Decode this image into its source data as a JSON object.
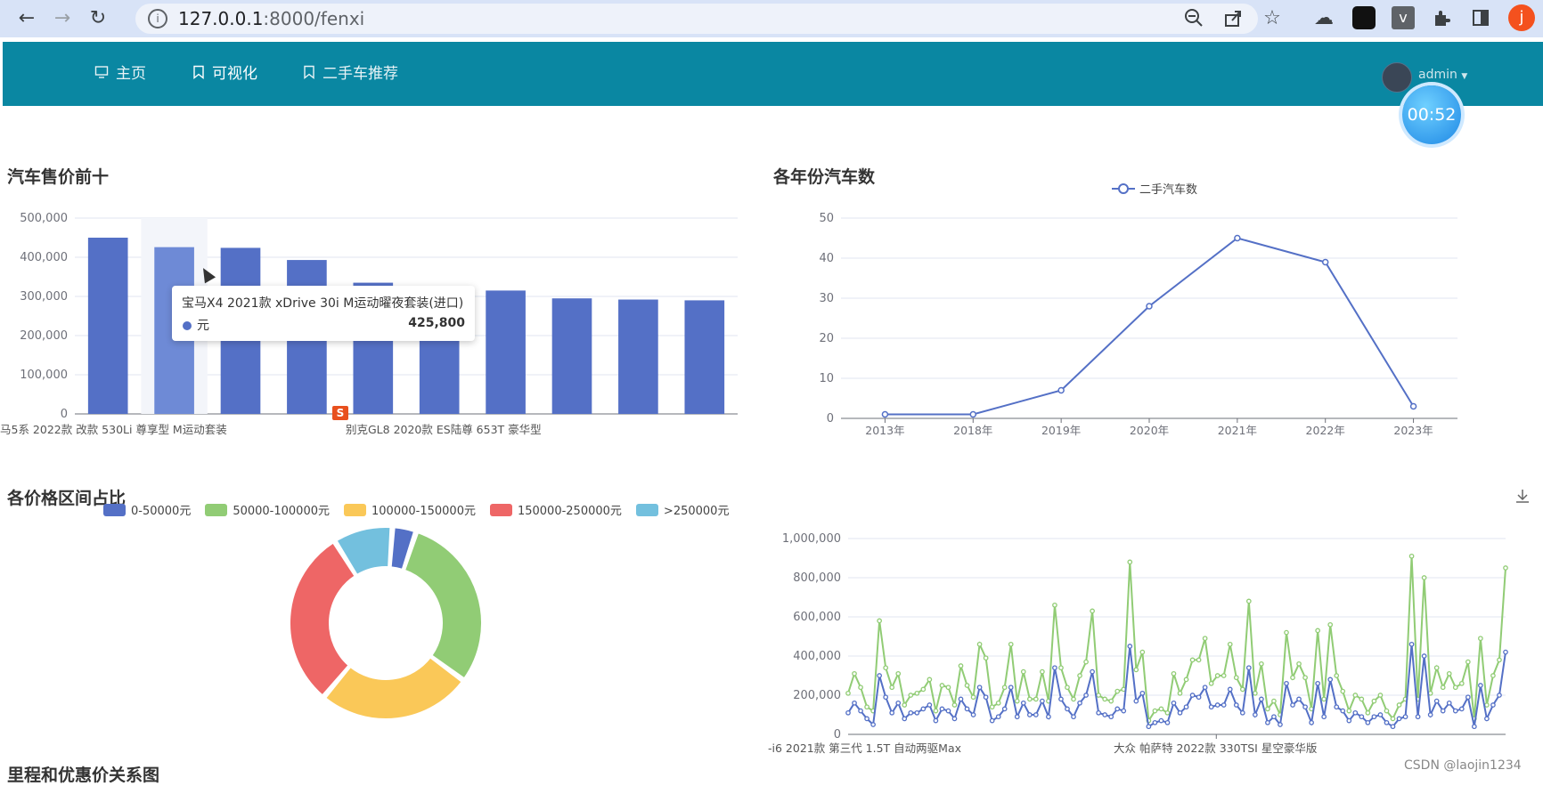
{
  "browser": {
    "url_host": "127.0.0.1",
    "url_path": ":8000/fenxi",
    "profile_initial": "j"
  },
  "nav": {
    "items": [
      {
        "label": "主页"
      },
      {
        "label": "可视化"
      },
      {
        "label": "二手车推荐"
      }
    ],
    "user": "admin",
    "timer": "00:52"
  },
  "charts": {
    "top_price": {
      "title": "汽车售价前十",
      "x_labels_shown": [
        "马5系 2022款 改款 530Li 尊享型 M运动套装",
        "别克GL8 2020款 ES陆尊 653T 豪华型"
      ],
      "tooltip": {
        "name": "宝马X4 2021款 xDrive 30i M运动曜夜套装(进口)",
        "series": "元",
        "value": "425,800"
      }
    },
    "year_count": {
      "title": "各年份汽车数",
      "legend": "二手汽车数"
    },
    "price_share": {
      "title": "各价格区间占比"
    },
    "mileage": {
      "title": "里程和优惠价关系图"
    },
    "price_lines": {
      "x_labels_shown": [
        "-i6 2021款 第三代 1.5T 自动两驱Max",
        "大众 帕萨特 2022款 330TSI 星空豪华版"
      ]
    }
  },
  "footer": {
    "credit": "CSDN @laojin1234"
  },
  "chart_data": [
    {
      "type": "bar",
      "categories": [
        "",
        "宝马X4 2021款 xDrive 30i M运动曜夜套装(进口)",
        "",
        "",
        "",
        "",
        "",
        "",
        "",
        ""
      ],
      "values": [
        450000,
        425800,
        424000,
        393000,
        335000,
        325000,
        315000,
        295000,
        292000,
        290000
      ],
      "ylim": [
        0,
        500000
      ],
      "yticks": [
        "0",
        "100,000",
        "200,000",
        "300,000",
        "400,000",
        "500,000"
      ],
      "color": "#5470c6",
      "highlight_index": 1
    },
    {
      "type": "line",
      "categories": [
        "2013年",
        "2018年",
        "2019年",
        "2020年",
        "2021年",
        "2022年",
        "2023年"
      ],
      "series": [
        {
          "name": "二手汽车数",
          "values": [
            1,
            1,
            7,
            28,
            45,
            39,
            3
          ]
        }
      ],
      "ylim": [
        0,
        50
      ],
      "yticks": [
        "0",
        "10",
        "20",
        "30",
        "40",
        "50"
      ],
      "color": "#5470c6"
    },
    {
      "type": "pie",
      "series": [
        {
          "name": "0-50000元",
          "value": 4,
          "color": "#5470c6"
        },
        {
          "name": "50000-100000元",
          "value": 30,
          "color": "#91cc75"
        },
        {
          "name": "100000-150000元",
          "value": 26,
          "color": "#fac858"
        },
        {
          "name": "150000-250000元",
          "value": 30,
          "color": "#ee6666"
        },
        {
          "name": ">250000元",
          "value": 10,
          "color": "#73c0de"
        }
      ]
    },
    {
      "type": "line",
      "ylim": [
        0,
        1000000
      ],
      "yticks": [
        "0",
        "200,000",
        "400,000",
        "600,000",
        "800,000",
        "1,000,000"
      ],
      "series": [
        {
          "color": "#5470c6",
          "values": [
            110000,
            160000,
            120000,
            80000,
            50000,
            300000,
            190000,
            110000,
            160000,
            80000,
            110000,
            110000,
            130000,
            150000,
            70000,
            130000,
            120000,
            80000,
            180000,
            130000,
            100000,
            240000,
            190000,
            70000,
            90000,
            130000,
            240000,
            90000,
            160000,
            100000,
            100000,
            170000,
            90000,
            340000,
            180000,
            130000,
            90000,
            160000,
            200000,
            320000,
            110000,
            100000,
            90000,
            130000,
            120000,
            450000,
            170000,
            210000,
            40000,
            60000,
            70000,
            60000,
            160000,
            110000,
            140000,
            200000,
            190000,
            240000,
            140000,
            150000,
            150000,
            230000,
            150000,
            110000,
            340000,
            100000,
            180000,
            60000,
            90000,
            50000,
            260000,
            150000,
            180000,
            140000,
            60000,
            260000,
            90000,
            280000,
            140000,
            120000,
            70000,
            110000,
            90000,
            60000,
            90000,
            100000,
            60000,
            40000,
            80000,
            90000,
            460000,
            90000,
            400000,
            100000,
            170000,
            120000,
            160000,
            120000,
            130000,
            190000,
            40000,
            250000,
            80000,
            150000,
            200000,
            420000
          ]
        },
        {
          "color": "#91cc75",
          "values": [
            210000,
            310000,
            240000,
            140000,
            120000,
            580000,
            340000,
            240000,
            310000,
            150000,
            200000,
            210000,
            230000,
            280000,
            120000,
            250000,
            240000,
            150000,
            350000,
            250000,
            190000,
            460000,
            390000,
            140000,
            160000,
            240000,
            460000,
            170000,
            320000,
            180000,
            180000,
            320000,
            170000,
            660000,
            340000,
            240000,
            180000,
            300000,
            370000,
            630000,
            200000,
            180000,
            170000,
            220000,
            230000,
            880000,
            330000,
            420000,
            70000,
            120000,
            130000,
            110000,
            310000,
            210000,
            280000,
            380000,
            380000,
            490000,
            260000,
            300000,
            300000,
            460000,
            290000,
            230000,
            680000,
            210000,
            360000,
            130000,
            170000,
            100000,
            520000,
            290000,
            360000,
            290000,
            130000,
            530000,
            180000,
            560000,
            300000,
            220000,
            120000,
            200000,
            180000,
            110000,
            170000,
            200000,
            120000,
            80000,
            150000,
            180000,
            910000,
            180000,
            800000,
            210000,
            340000,
            240000,
            310000,
            240000,
            260000,
            370000,
            80000,
            490000,
            150000,
            300000,
            380000,
            850000
          ]
        }
      ]
    }
  ]
}
